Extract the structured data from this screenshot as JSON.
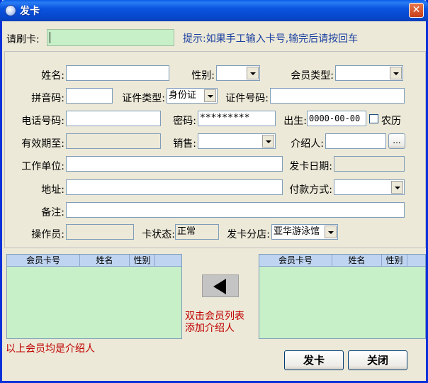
{
  "window": {
    "title": "发卡"
  },
  "card_bar": {
    "label": "请刷卡:",
    "value": "",
    "hint": "提示:如果手工输入卡号,输完后请按回车"
  },
  "form": {
    "name_label": "姓名:",
    "name_value": "",
    "gender_label": "性别:",
    "gender_value": "",
    "member_type_label": "会员类型:",
    "member_type_value": "",
    "pinyin_label": "拼音码:",
    "pinyin_value": "",
    "id_type_label": "证件类型:",
    "id_type_value": "身份证",
    "id_number_label": "证件号码:",
    "id_number_value": "",
    "phone_label": "电话号码:",
    "phone_value": "",
    "password_label": "密码:",
    "password_value": "*********",
    "birth_label": "出生:",
    "birth_value": "0000-00-00",
    "lunar_label": "农历",
    "lunar_checked": false,
    "valid_until_label": "有效期至:",
    "valid_until_value": "",
    "sales_label": "销售:",
    "sales_value": "",
    "referrer_label": "介绍人:",
    "referrer_value": "",
    "referrer_button": "...",
    "employer_label": "工作单位:",
    "employer_value": "",
    "issue_date_label": "发卡日期:",
    "issue_date_value": "",
    "address_label": "地址:",
    "address_value": "",
    "payment_label": "付款方式:",
    "payment_value": "",
    "remark_label": "备注:",
    "remark_value": "",
    "operator_label": "操作员:",
    "operator_value": "",
    "card_status_label": "卡状态:",
    "card_status_value": "正常",
    "branch_label": "发卡分店:",
    "branch_value": "亚华游泳馆"
  },
  "left_grid": {
    "columns": [
      "会员卡号",
      "姓名",
      "性别"
    ],
    "rows": [],
    "note": "以上会员均是介绍人"
  },
  "right_grid": {
    "columns": [
      "会员卡号",
      "姓名",
      "性别"
    ],
    "rows": []
  },
  "middle_hint": {
    "line1": "双击会员列表",
    "line2": "添加介绍人"
  },
  "buttons": {
    "issue": "发卡",
    "close": "关闭"
  },
  "colors": {
    "title_bar": "#0a54e0",
    "highlight_field": "#c8f0c8",
    "grid_bg": "#c8f0c8",
    "hint_text": "#1a3fa0",
    "red_text": "#c00000"
  }
}
